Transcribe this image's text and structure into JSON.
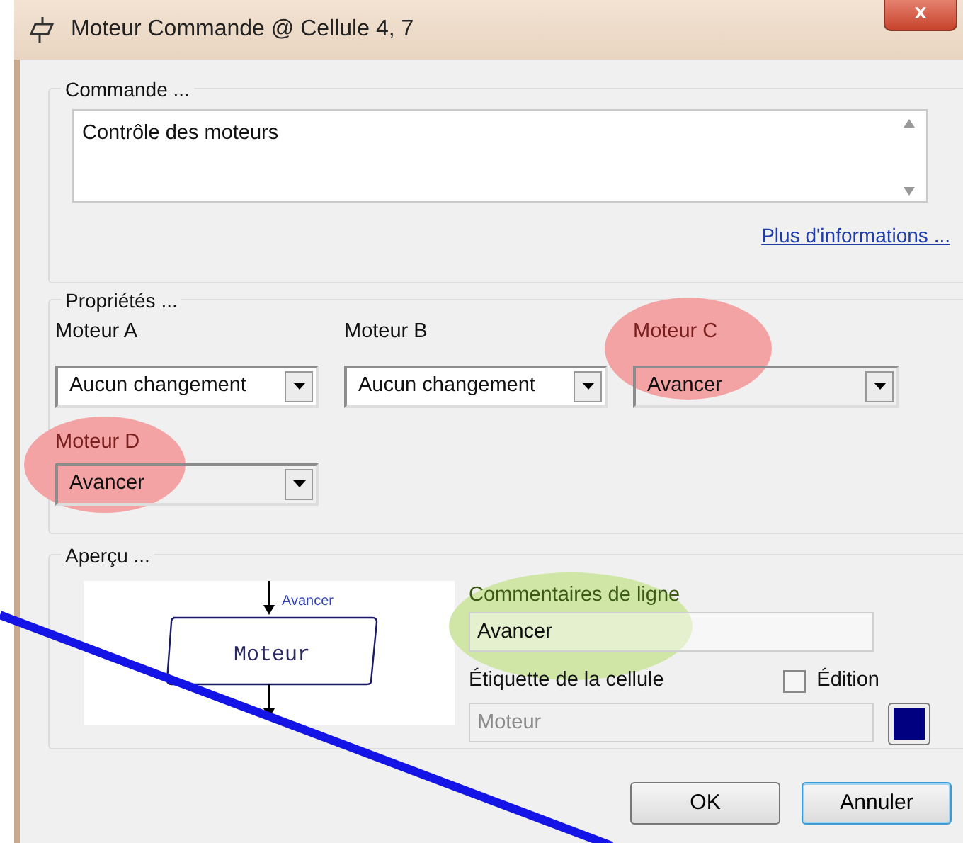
{
  "window": {
    "title": "Moteur Commande @ Cellule 4, 7",
    "close": "x"
  },
  "commande": {
    "legend": "Commande ...",
    "text": "Contrôle des moteurs",
    "link": "Plus d'informations ..."
  },
  "proprietes": {
    "legend": "Propriétés ...",
    "motors": [
      {
        "label": "Moteur A",
        "value": "Aucun changement"
      },
      {
        "label": "Moteur B",
        "value": "Aucun changement"
      },
      {
        "label": "Moteur C",
        "value": "Avancer",
        "color": "#f3a3a3"
      },
      {
        "label": "Moteur D",
        "value": "Avancer",
        "color": "#f3a3a3"
      }
    ]
  },
  "apercu": {
    "legend": "Aperçu ...",
    "diagram": {
      "arrow_label": "Avancer",
      "block": "Moteur"
    },
    "comment": {
      "label": "Commentaires de ligne",
      "value": "Avancer",
      "color": "#cfe6a6"
    },
    "cell_label": {
      "label": "Étiquette de la cellule",
      "value": "Moteur",
      "disabled": true
    },
    "edition": {
      "label": "Édition",
      "checked": false
    },
    "swatch": {
      "color": "#000080"
    }
  },
  "buttons": [
    {
      "label": "OK",
      "focused": false
    },
    {
      "label": "Annuler",
      "focused": true
    }
  ],
  "annotations": [
    {
      "kind": "line",
      "color": "#1414e6"
    }
  ]
}
